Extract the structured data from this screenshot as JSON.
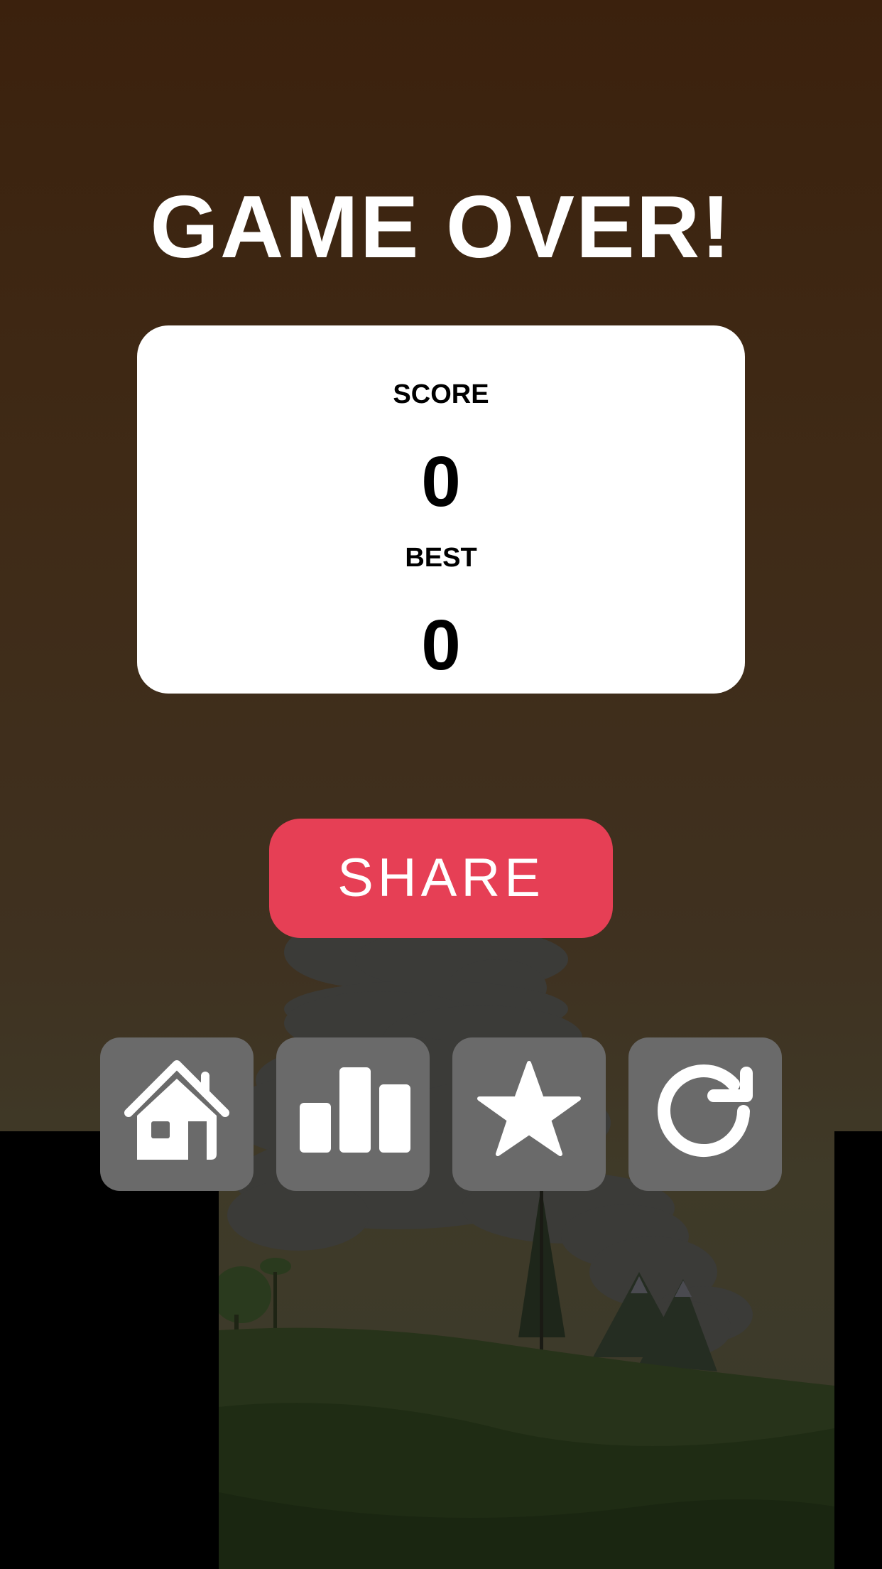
{
  "screen": {
    "title": "GAME OVER!"
  },
  "score_card": {
    "score_label": "SCORE",
    "score_value": "0",
    "best_label": "BEST",
    "best_value": "0"
  },
  "share_button": {
    "label": "SHARE",
    "color": "#e63f55"
  },
  "icon_buttons": [
    {
      "icon": "home-icon"
    },
    {
      "icon": "leaderboard-icon"
    },
    {
      "icon": "star-icon"
    },
    {
      "icon": "restart-icon"
    }
  ],
  "colors": {
    "overlay_bg": "#3b210d",
    "card_bg": "#ffffff",
    "icon_button_bg": "#6a6a6a"
  }
}
